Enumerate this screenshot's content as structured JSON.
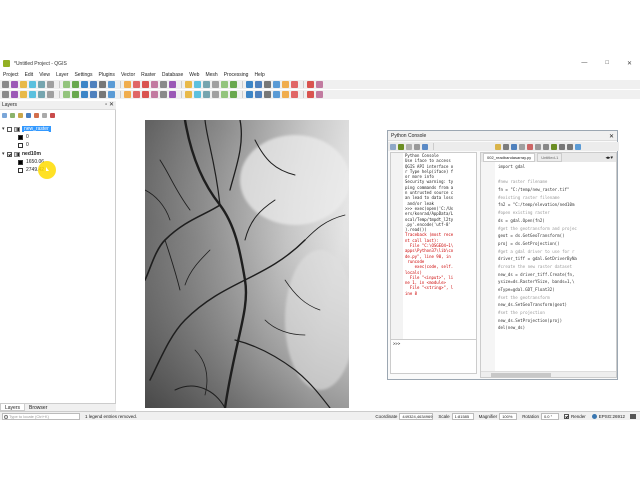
{
  "window": {
    "title": "*Untitled Project - QGIS",
    "controls": [
      "—",
      "□",
      "✕"
    ]
  },
  "menubar": [
    "Project",
    "Edit",
    "View",
    "Layer",
    "Settings",
    "Plugins",
    "Vector",
    "Raster",
    "Database",
    "Web",
    "Mesh",
    "Processing",
    "Help"
  ],
  "layers_panel": {
    "title": "Layers",
    "layers": [
      {
        "name": "new_raster",
        "checked": false,
        "selected": true,
        "legend": [
          {
            "label": "0",
            "color": "#000000"
          },
          {
            "label": "0",
            "color": "#ffffff"
          }
        ]
      },
      {
        "name": "ned10m",
        "checked": true,
        "selected": false,
        "legend": [
          {
            "label": "1650.06",
            "color": "#000000"
          },
          {
            "label": "2749.42",
            "color": "#ffffff"
          }
        ]
      }
    ],
    "tabs": [
      "Layers",
      "Browser"
    ]
  },
  "python_console": {
    "title": "Python Console",
    "shell_lines": [
      {
        "t": "Python Console",
        "style": ""
      },
      {
        "t": "Use iface to access",
        "style": ""
      },
      {
        "t": "QGIS API interface o",
        "style": ""
      },
      {
        "t": "r Type help(iface) f",
        "style": ""
      },
      {
        "t": "or more info",
        "style": ""
      },
      {
        "t": "Security warning: ty",
        "style": ""
      },
      {
        "t": "ping commands from a",
        "style": ""
      },
      {
        "t": "n untrusted source c",
        "style": ""
      },
      {
        "t": "an lead to data loss",
        "style": ""
      },
      {
        "t": " and/or leak",
        "style": ""
      },
      {
        "t": ">>> exec(open('C:/Us",
        "style": ""
      },
      {
        "t": "ers/konrad/AppData/L",
        "style": ""
      },
      {
        "t": "ocal/Temp/tmpdt_l2ty",
        "style": ""
      },
      {
        "t": ".py'.encode('utf-8'",
        "style": ""
      },
      {
        "t": ").read())",
        "style": ""
      },
      {
        "t": "Traceback (most rece",
        "style": "red"
      },
      {
        "t": "nt call last):",
        "style": "red"
      },
      {
        "t": "  File \"C:\\OSGEO4~1\\",
        "style": "red"
      },
      {
        "t": "apps\\Python37\\lib\\co",
        "style": "red"
      },
      {
        "t": "de.py\", line 90, in",
        "style": "red"
      },
      {
        "t": " runcode",
        "style": "red"
      },
      {
        "t": "    exec(code, self.",
        "style": "red"
      },
      {
        "t": "locals)",
        "style": "red"
      },
      {
        "t": "  File \"<input>\", li",
        "style": "red"
      },
      {
        "t": "ne 1, in <module>",
        "style": "red"
      },
      {
        "t": "  File \"<string>\", l",
        "style": "red"
      },
      {
        "t": "ine 8",
        "style": "red"
      }
    ],
    "prompt": ">>>",
    "editor_tabs": [
      "002_readbandasarray.py",
      "Untitled-1"
    ],
    "code_lines": [
      {
        "n": "1",
        "t": "import gdal",
        "style": ""
      },
      {
        "n": "2",
        "t": "",
        "style": ""
      },
      {
        "n": "3",
        "t": "#new raster filename",
        "style": "comment"
      },
      {
        "n": "4",
        "t": "fn = \"C:/temp/new_raster.tif\"",
        "style": ""
      },
      {
        "n": "5",
        "t": "#existing raster filename",
        "style": "comment"
      },
      {
        "n": "6",
        "t": "fn2 = \"C:/temp/elevation/ned10m",
        "style": ""
      },
      {
        "n": "7",
        "t": "#open existing raster",
        "style": "comment"
      },
      {
        "n": "8",
        "t": "ds = gdal.Open(fn2)",
        "style": ""
      },
      {
        "n": "9",
        "t": "#get the geotransform and projec",
        "style": "comment"
      },
      {
        "n": "10",
        "t": "geot = ds.GetGeoTransform()",
        "style": ""
      },
      {
        "n": "11",
        "t": "proj = ds.GetProjection()",
        "style": ""
      },
      {
        "n": "12",
        "t": "#get a gdal driver to use for r",
        "style": "comment"
      },
      {
        "n": "13",
        "t": "driver_tiff = gdal.GetDriverByNa",
        "style": ""
      },
      {
        "n": "14",
        "t": "#create the new raster dataset",
        "style": "comment"
      },
      {
        "n": "15",
        "t": "new_ds = driver_tiff.Create(fn,",
        "style": ""
      },
      {
        "n": "",
        "t": "ysize=ds.RasterYSize, bands=1,\\",
        "style": ""
      },
      {
        "n": "",
        "t": "eType=gdal.GDT_Float32)",
        "style": ""
      },
      {
        "n": "16",
        "t": "#set the geotransform",
        "style": "comment"
      },
      {
        "n": "17",
        "t": "new_ds.SetGeoTransform(geot)",
        "style": ""
      },
      {
        "n": "18",
        "t": "#set the projection",
        "style": "comment"
      },
      {
        "n": "19",
        "t": "new_ds.SetProjection(proj)",
        "style": ""
      },
      {
        "n": "20",
        "t": "del(new_ds)",
        "style": ""
      },
      {
        "n": "21",
        "t": "",
        "style": ""
      }
    ]
  },
  "statusbar": {
    "search_placeholder": "Type to locate (Ctrl+K)",
    "message": "1 legend entries removed.",
    "coordinate_label": "Coordinate",
    "coordinate_value": "449324,4634969",
    "scale_label": "Scale",
    "scale_value": "1:81585",
    "magnifier_label": "Magnifier",
    "magnifier_value": "100%",
    "rotation_label": "Rotation",
    "rotation_value": "0.0 °",
    "render_label": "Render",
    "crs_label": "EPSG:26912"
  },
  "colors": {
    "selected": "#3399ff",
    "qgis_green": "#93b023",
    "error_red": "#cc0000"
  }
}
